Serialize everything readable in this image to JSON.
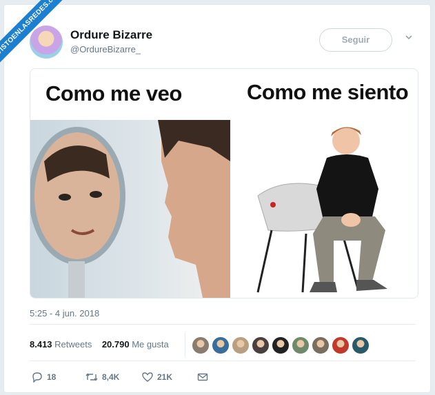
{
  "watermark": "VISTOENLASREDES.com",
  "tweet": {
    "name": "Ordure Bizarre",
    "handle": "@OrdureBizarre_",
    "follow_label": "Seguir",
    "image": {
      "left_caption": "Como me veo",
      "right_caption": "Como me siento"
    },
    "timestamp": "5:25 - 4 jun. 2018",
    "retweets_count": "8.413",
    "retweets_label": "Retweets",
    "likes_count": "20.790",
    "likes_label": "Me gusta",
    "liker_colors": [
      "#8a7d70",
      "#3a6d9a",
      "#b89f80",
      "#4a4040",
      "#222222",
      "#6e8a6a",
      "#7a6f5e",
      "#c0392b",
      "#2a5a6a"
    ],
    "actions": {
      "replies": "18",
      "retweets": "8,4K",
      "likes": "21K"
    }
  }
}
